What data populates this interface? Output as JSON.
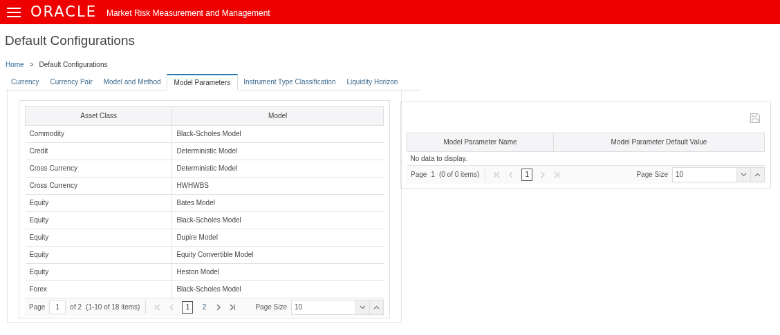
{
  "header": {
    "logo": "ORACLE",
    "app_title": "Market Risk Measurement and Management"
  },
  "page_title": "Default Configurations",
  "breadcrumb": [
    {
      "label": "Home",
      "link": true
    },
    {
      "label": "Default Configurations",
      "link": false
    }
  ],
  "breadcrumb_separator": ">",
  "tabs": [
    {
      "label": "Currency",
      "selected": false
    },
    {
      "label": "Currency Pair",
      "selected": false
    },
    {
      "label": "Model and Method",
      "selected": false
    },
    {
      "label": "Model Parameters",
      "selected": true
    },
    {
      "label": "Instrument Type Classification",
      "selected": false
    },
    {
      "label": "Liquidity Horizon",
      "selected": false
    }
  ],
  "left_table": {
    "columns": [
      "Asset Class",
      "Model"
    ],
    "rows": [
      [
        "Commodity",
        "Black-Scholes Model"
      ],
      [
        "Credit",
        "Deterministic Model"
      ],
      [
        "Cross Currency",
        "Deterministic Model"
      ],
      [
        "Cross Currency",
        "HWHWBS"
      ],
      [
        "Equity",
        "Bates Model"
      ],
      [
        "Equity",
        "Black-Scholes Model"
      ],
      [
        "Equity",
        "Dupire Model"
      ],
      [
        "Equity",
        "Equity Convertible Model"
      ],
      [
        "Equity",
        "Heston Model"
      ],
      [
        "Forex",
        "Black-Scholes Model"
      ]
    ],
    "pager": {
      "page_label": "Page",
      "page": {
        "kind": "input",
        "value": "1"
      },
      "of": "of 2",
      "summary": "(1-10 of 18 items)",
      "nav": [
        {
          "kind": "first",
          "disabled": true
        },
        {
          "kind": "prev",
          "disabled": true
        },
        {
          "kind": "pages"
        },
        {
          "kind": "next",
          "disabled": false
        },
        {
          "kind": "last",
          "disabled": false
        }
      ],
      "pages": [
        {
          "label": "1",
          "selected": true
        },
        {
          "label": "2",
          "selected": false
        }
      ],
      "page_size_label": "Page Size",
      "page_size": "10"
    }
  },
  "right_table": {
    "columns": [
      "Model Parameter Name",
      "Model Parameter Default Value"
    ],
    "empty_message": "No data to display.",
    "pager": {
      "page_label": "Page",
      "page": {
        "kind": "text",
        "value": "1"
      },
      "summary": "(0 of 0 items)",
      "nav": [
        {
          "kind": "first",
          "disabled": true
        },
        {
          "kind": "prev",
          "disabled": true
        },
        {
          "kind": "pages"
        },
        {
          "kind": "next",
          "disabled": true
        },
        {
          "kind": "last",
          "disabled": true
        }
      ],
      "pages": [
        {
          "label": "1",
          "selected": true
        }
      ],
      "page_size_label": "Page Size",
      "page_size": "10"
    }
  }
}
